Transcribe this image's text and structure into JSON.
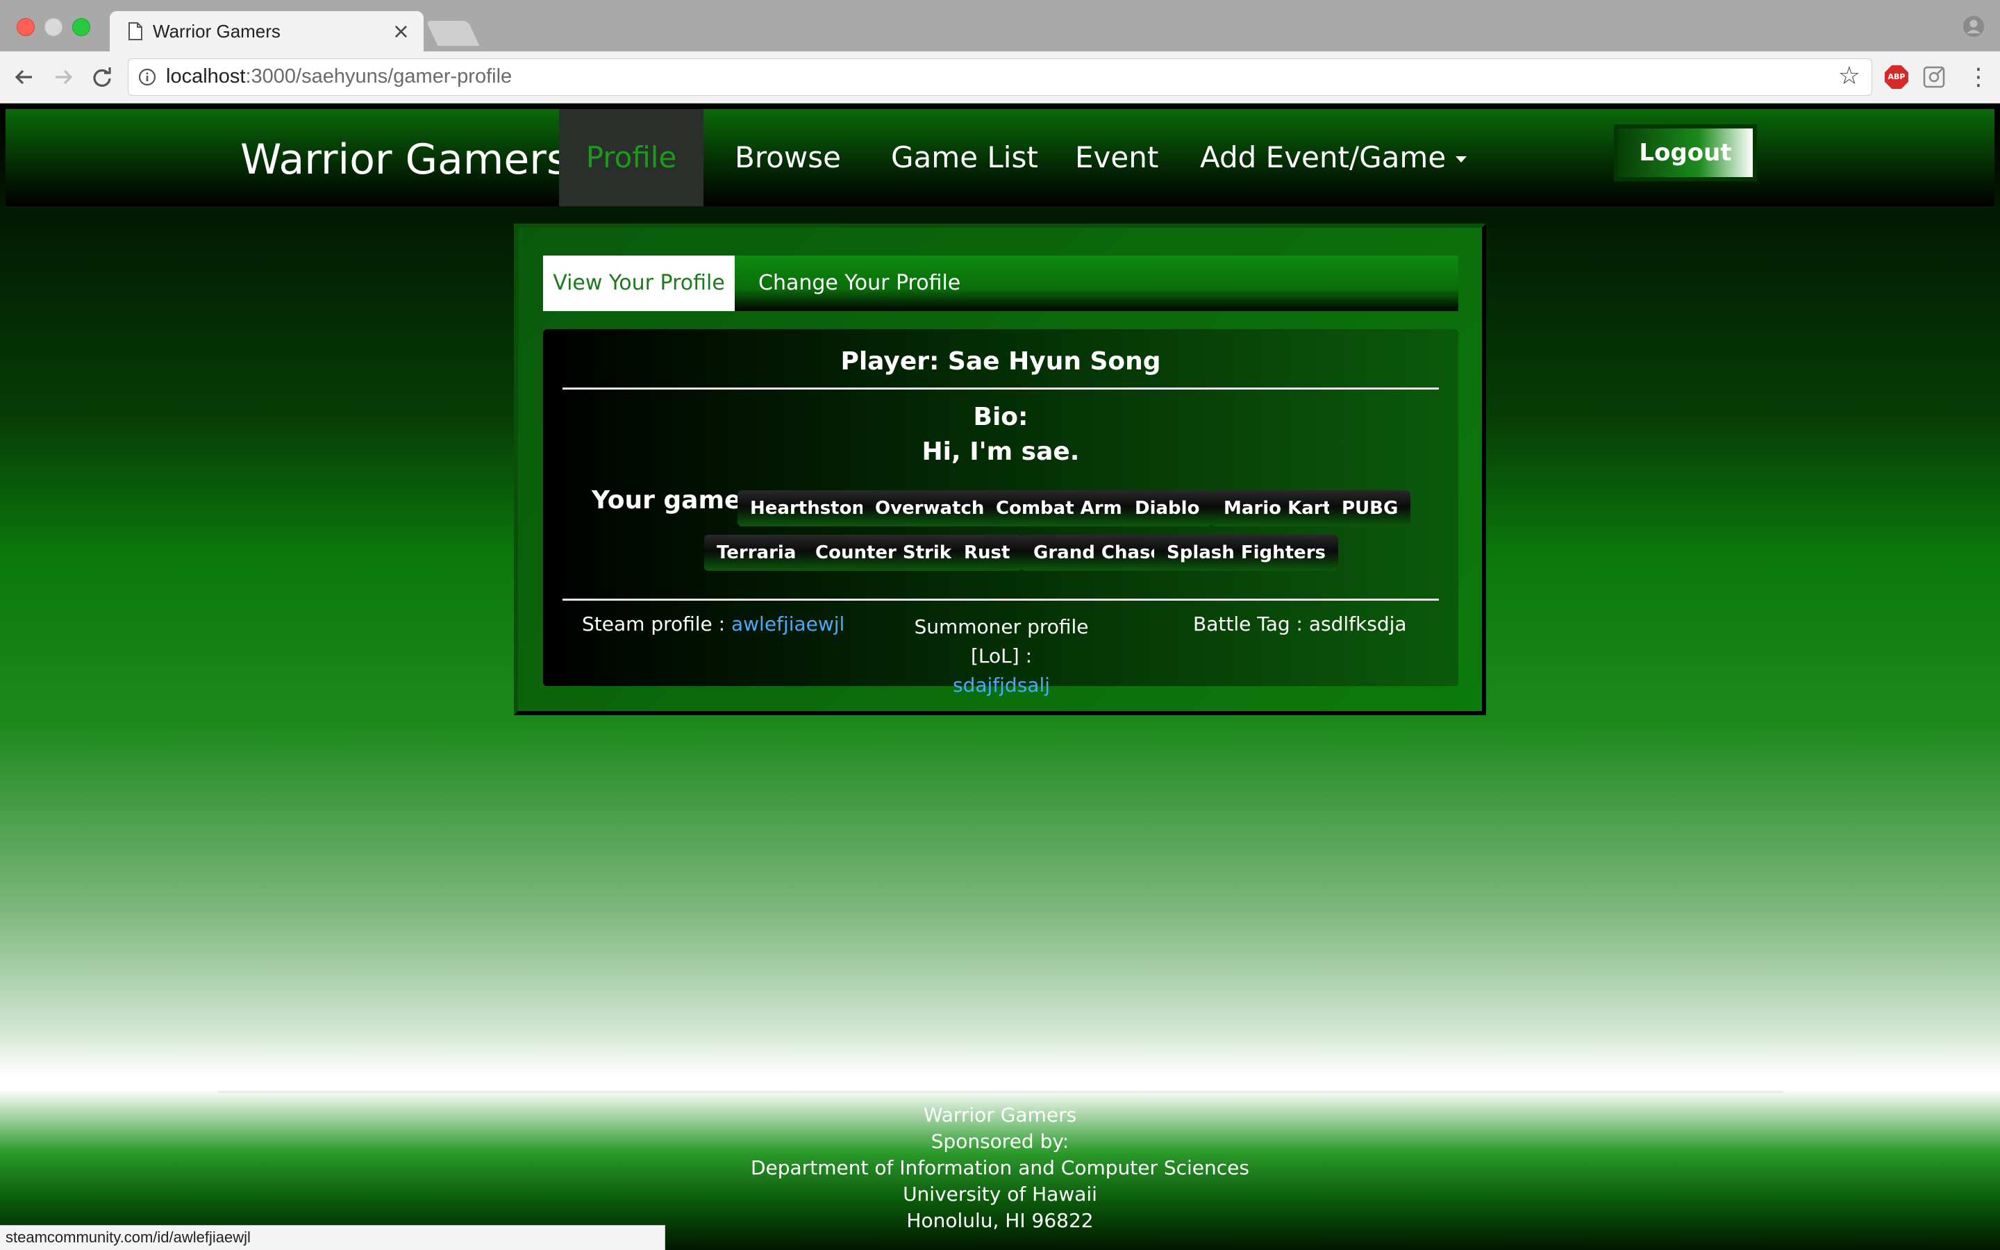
{
  "browser": {
    "tab_title": "Warrior Gamers",
    "tab_close": "×",
    "url_host": "localhost",
    "url_path": ":3000/saehyuns/gamer-profile",
    "ext_abp": "ABP",
    "status_url": "steamcommunity.com/id/awlefjiaewjl"
  },
  "navbar": {
    "brand": "Warrior Gamers",
    "items": [
      {
        "label": "Profile",
        "active": true
      },
      {
        "label": "Browse"
      },
      {
        "label": "Game List"
      },
      {
        "label": "Event"
      },
      {
        "label": "Add Event/Game",
        "dropdown": true
      }
    ],
    "logout": "Logout"
  },
  "profile": {
    "tabs": [
      "View Your Profile",
      "Change Your Profile"
    ],
    "player_title": "Player: Sae Hyun Song",
    "bio_label": "Bio:",
    "bio_text": "Hi, I'm sae.",
    "games_label": "Your games:",
    "games": [
      "Hearthstone",
      "Overwatch",
      "Combat Arms",
      "Diablo",
      "Mario Kart",
      "PUBG",
      "Terraria",
      "Counter Strike",
      "Rust",
      "Grand Chase",
      "Splash Fighters"
    ],
    "steam_label": "Steam profile :",
    "steam_value": "awlefjiaewjl",
    "summoner_label": "Summoner profile [LoL] :",
    "summoner_value": "sdajfjdsalj",
    "battletag_label": "Battle Tag :",
    "battletag_value": "asdlfksdja"
  },
  "footer": {
    "lines": [
      "Warrior Gamers",
      "Sponsored by:",
      "Department of Information and Computer Sciences",
      "University of Hawaii",
      "Honolulu, HI 96822"
    ]
  },
  "colors": {
    "brand_green": "#0b780b",
    "active_nav": "#1b9a1b",
    "link_blue": "#4aa8ff"
  }
}
